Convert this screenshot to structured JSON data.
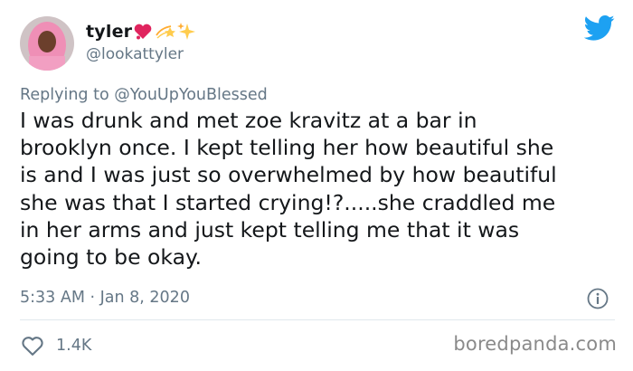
{
  "author": {
    "display_name": "tyler",
    "handle": "@lookattyler"
  },
  "icons": {
    "brand": "twitter-bird-icon",
    "info": "info-icon",
    "like": "heart-icon",
    "name_emojis": [
      "heart-exclamation-emoji",
      "dizzy-star-emoji",
      "sparkles-emoji"
    ]
  },
  "reply": {
    "prefix": "Replying to",
    "mention": "@YouUpYouBlessed"
  },
  "tweet_text": "I was drunk and met zoe kravitz at a bar in\nbrooklyn once. I kept telling her how beautiful she\nis and I was just so overwhelmed by how beautiful\nshe was that I started crying!?.....she craddled me\nin her arms and just kept telling me that it was\ngoing to be okay.",
  "timestamp": "5:33 AM · Jan 8, 2020",
  "likes": "1.4K",
  "watermark": "boredpanda.com",
  "colors": {
    "brand_blue": "#1da1f2",
    "text": "#14171a",
    "muted": "#657786",
    "divider": "#e1e8ed"
  }
}
